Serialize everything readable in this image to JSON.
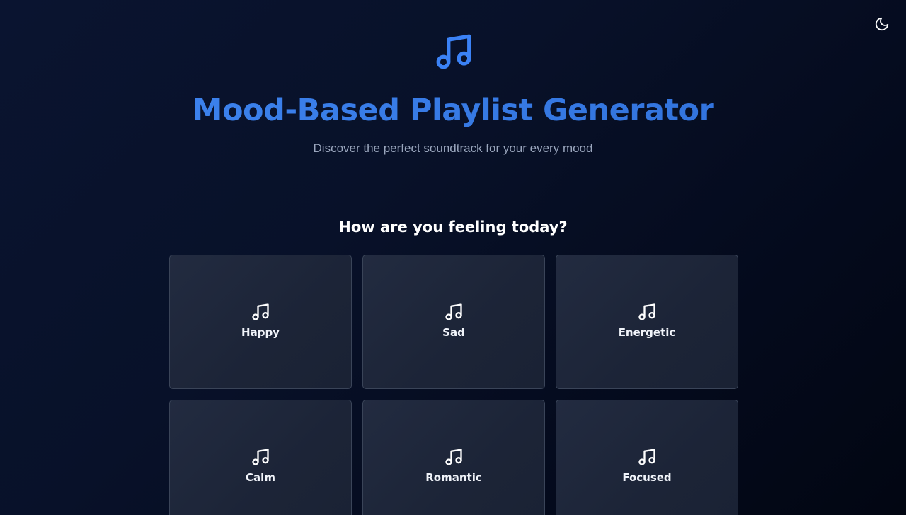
{
  "header": {
    "title": "Mood-Based Playlist Generator",
    "subtitle": "Discover the perfect soundtrack for your every mood",
    "logo_icon": "music-note-icon"
  },
  "theme_toggle": {
    "icon": "moon-icon"
  },
  "mood_section": {
    "question": "How are you feeling today?",
    "moods": [
      {
        "label": "Happy",
        "icon": "music-note-icon"
      },
      {
        "label": "Sad",
        "icon": "music-note-icon"
      },
      {
        "label": "Energetic",
        "icon": "music-note-icon"
      },
      {
        "label": "Calm",
        "icon": "music-note-icon"
      },
      {
        "label": "Romantic",
        "icon": "music-note-icon"
      },
      {
        "label": "Focused",
        "icon": "music-note-icon"
      }
    ]
  },
  "colors": {
    "accent": "#3b82f6",
    "background": "#081129",
    "card": "#1e2639",
    "subtitle": "#9aa6bd"
  }
}
